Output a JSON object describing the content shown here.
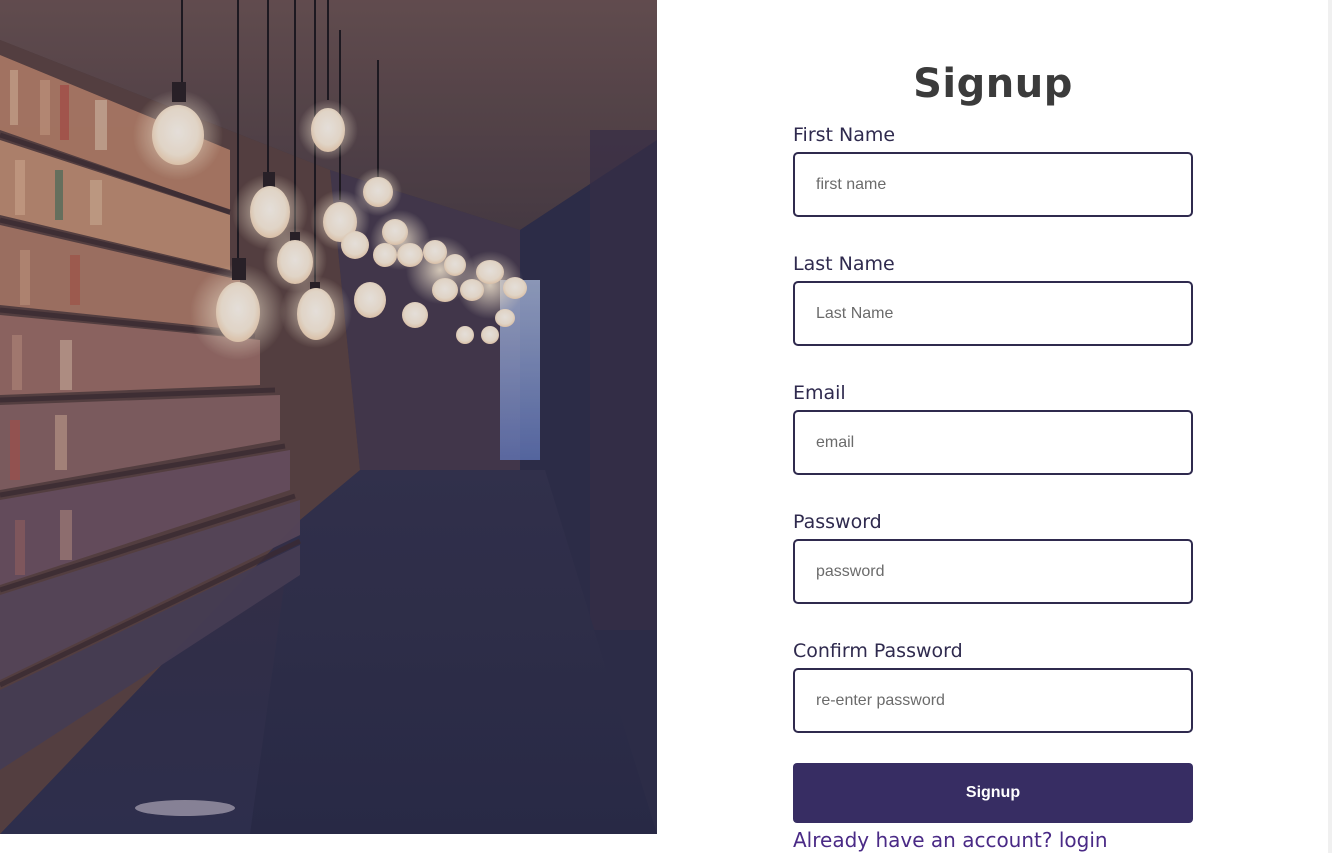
{
  "hero": {
    "image_name": "library-bookshelves-with-hanging-bulbs"
  },
  "form": {
    "title": "Signup",
    "fields": [
      {
        "label": "First Name",
        "placeholder": "first name",
        "value": ""
      },
      {
        "label": "Last Name",
        "placeholder": "Last Name",
        "value": ""
      },
      {
        "label": "Email",
        "placeholder": "email",
        "value": ""
      },
      {
        "label": "Password",
        "placeholder": "password",
        "value": ""
      },
      {
        "label": "Confirm Password",
        "placeholder": "re-enter password",
        "value": ""
      }
    ],
    "submit_label": "Signup",
    "login_prompt": "Already have an account?",
    "login_link": "login"
  },
  "colors": {
    "accent": "#372d63",
    "label_text": "#2f2a4e",
    "title_text": "#3b3b3b",
    "link_text": "#4a2a86"
  }
}
